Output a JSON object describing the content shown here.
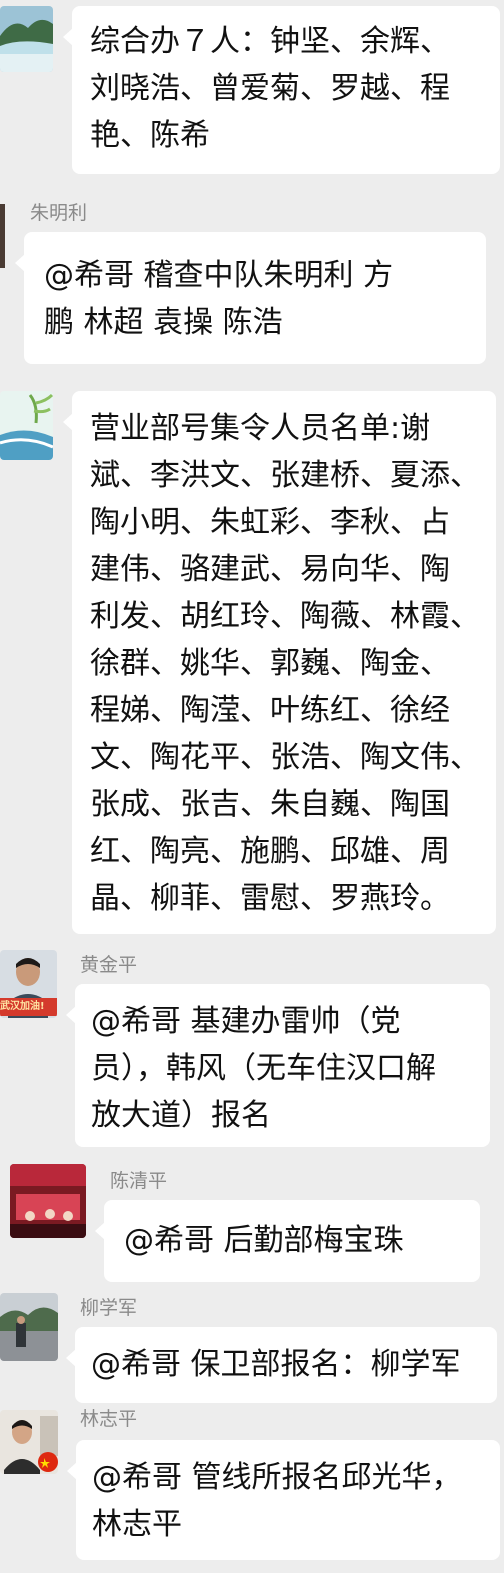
{
  "chat": {
    "messages": [
      {
        "sender": "",
        "avatar": "landscape-avatar-icon",
        "text": "综合办７人：钟坚、余辉、\n刘晓浩、曾爱菊、罗越、程\n艳、陈希"
      },
      {
        "sender": "朱明利",
        "avatar": "person-avatar-icon",
        "text": "@希哥  稽查中队朱明利  方\n鹏   林超   袁操    陈浩"
      },
      {
        "sender": "",
        "avatar": "bamboo-water-avatar-icon",
        "text": "营业部号集令人员名单:谢\n斌、李洪文、张建桥、夏添、\n陶小明、朱虹彩、李秋、占\n建伟、骆建武、易向华、陶\n利发、胡红玲、陶薇、林霞、\n徐群、姚华、郭巍、陶金、\n程娣、陶滢、叶练红、徐经\n文、陶花平、张浩、陶文伟、\n张成、张吉、朱自巍、陶国\n红、陶亮、施鹏、邱雄、周\n晶、柳菲、雷慰、罗燕玲。"
      },
      {
        "sender": "黄金平",
        "avatar": "wuhan-jiayou-avatar-icon",
        "avatar_text": "武汉加油!",
        "text": "@希哥  基建办雷帅（党\n员），韩风（无车住汉口解\n放大道）报名"
      },
      {
        "sender": "陈清平",
        "avatar": "stage-avatar-icon",
        "text": "@希哥  后勤部梅宝珠"
      },
      {
        "sender": "柳学军",
        "avatar": "street-avatar-icon",
        "text": "@希哥  保卫部报名：柳学军"
      },
      {
        "sender": "林志平",
        "avatar": "selfie-flag-avatar-icon",
        "text": "@希哥  管线所报名邱光华，\n林志平"
      }
    ]
  },
  "colors": {
    "background": "#ededed",
    "bubble": "#ffffff",
    "sender_name": "#8a8a8a",
    "text": "#111111"
  }
}
